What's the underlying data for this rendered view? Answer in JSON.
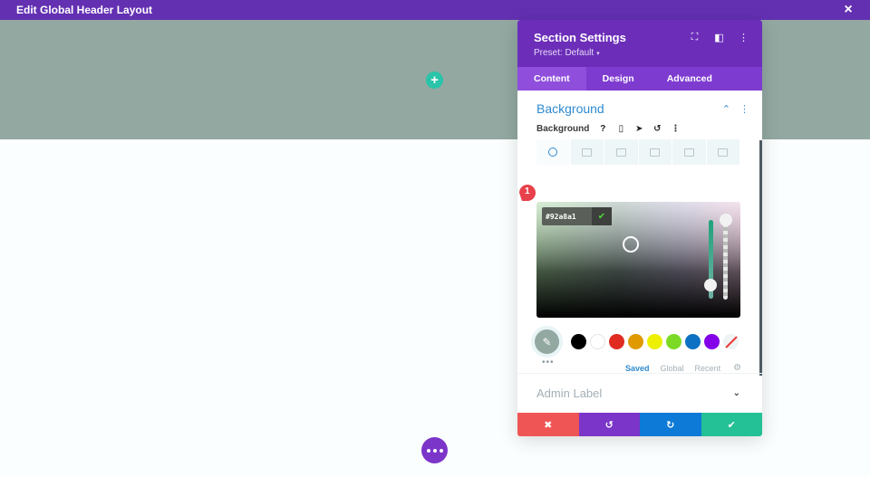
{
  "topbar": {
    "title": "Edit Global Header Layout",
    "close_icon": "×"
  },
  "canvas": {
    "section_background": "#92a8a1",
    "add_icon": "+"
  },
  "modal": {
    "title": "Section Settings",
    "preset": "Preset: Default",
    "preset_caret": "▾",
    "header_icons": {
      "expand": "⛶",
      "sidebar": "◧",
      "menu": "⋮"
    },
    "tabs": [
      {
        "label": "Content",
        "active": true
      },
      {
        "label": "Design",
        "active": false
      },
      {
        "label": "Advanced",
        "active": false
      }
    ],
    "background_section": {
      "heading": "Background",
      "collapse_icon": "⌃",
      "menu_icon": "⋮",
      "field_label": "Background",
      "field_icons": {
        "help": "?",
        "device": "▯",
        "hover": "➤",
        "reset": "↺",
        "menu": "⋮"
      },
      "type_tabs": [
        "color",
        "gradient",
        "image",
        "video",
        "pattern",
        "mask"
      ],
      "active_type": "color",
      "color_picker": {
        "hex_value": "#92a8a1",
        "confirm_icon": "✔",
        "badge_number": "1"
      },
      "swatches": [
        {
          "name": "black",
          "color": "#000000"
        },
        {
          "name": "white",
          "color": "#ffffff"
        },
        {
          "name": "red",
          "color": "#e02b20"
        },
        {
          "name": "orange",
          "color": "#e09900"
        },
        {
          "name": "yellow",
          "color": "#edf000"
        },
        {
          "name": "green",
          "color": "#7cda24"
        },
        {
          "name": "blue",
          "color": "#0c71c3"
        },
        {
          "name": "purple",
          "color": "#8300e9"
        }
      ],
      "palette_tabs": [
        {
          "label": "Saved",
          "active": true
        },
        {
          "label": "Global",
          "active": false
        },
        {
          "label": "Recent",
          "active": false
        }
      ],
      "more_dots": "•••"
    },
    "admin_label": {
      "heading": "Admin Label",
      "chevron": "⌄"
    },
    "footer": {
      "cancel": "✖",
      "undo": "↺",
      "redo": "↻",
      "save": "✔"
    }
  }
}
